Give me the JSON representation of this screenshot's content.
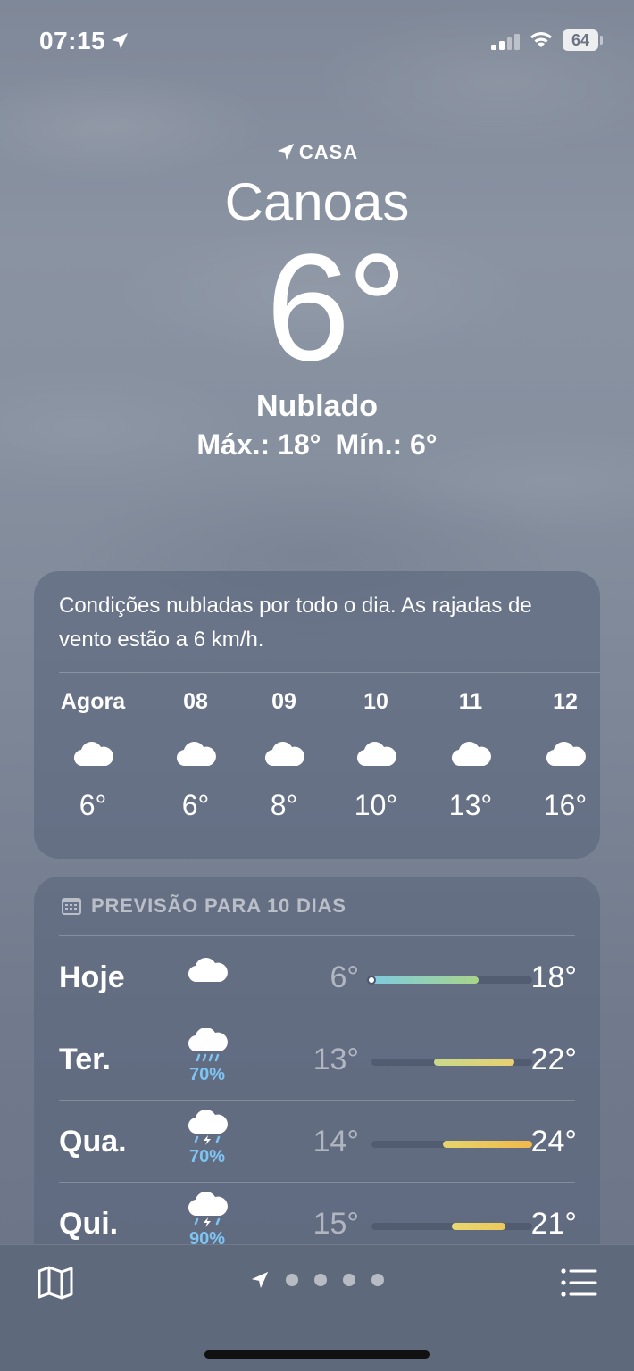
{
  "status_bar": {
    "time": "07:15",
    "battery": "64"
  },
  "header": {
    "location_label": "CASA",
    "city": "Canoas",
    "temperature": "6°",
    "condition": "Nublado",
    "high": "Máx.: 18°",
    "low": "Mín.: 6°"
  },
  "hourly": {
    "summary": "Condições nubladas por todo o dia. As rajadas de vento estão a 6 km/h.",
    "items": [
      {
        "time": "Agora",
        "icon": "cloud-icon",
        "temp": "6°"
      },
      {
        "time": "08",
        "icon": "cloud-icon",
        "temp": "6°"
      },
      {
        "time": "09",
        "icon": "cloud-icon",
        "temp": "8°"
      },
      {
        "time": "10",
        "icon": "cloud-icon",
        "temp": "10°"
      },
      {
        "time": "11",
        "icon": "cloud-icon",
        "temp": "13°"
      },
      {
        "time": "12",
        "icon": "cloud-icon",
        "temp": "16°"
      }
    ]
  },
  "daily": {
    "header": "PREVISÃO PARA 10 DIAS",
    "range": [
      6,
      24
    ],
    "days": [
      {
        "name": "Hoje",
        "icon": "cloud-icon",
        "precip": "",
        "low": "6°",
        "high": "18°",
        "low_val": 6,
        "high_val": 18,
        "current_val": 6,
        "bar_colors": [
          "#7dcbe0",
          "#a8d48a"
        ]
      },
      {
        "name": "Ter.",
        "icon": "cloud-rain-icon",
        "precip": "70%",
        "low": "13°",
        "high": "22°",
        "low_val": 13,
        "high_val": 22,
        "bar_colors": [
          "#c9d88a",
          "#e8d070"
        ]
      },
      {
        "name": "Qua.",
        "icon": "cloud-bolt-rain-icon",
        "precip": "70%",
        "low": "14°",
        "high": "24°",
        "low_val": 14,
        "high_val": 24,
        "bar_colors": [
          "#e6d46c",
          "#f0b94a"
        ]
      },
      {
        "name": "Qui.",
        "icon": "cloud-bolt-rain-icon",
        "precip": "90%",
        "low": "15°",
        "high": "21°",
        "low_val": 15,
        "high_val": 21,
        "bar_colors": [
          "#e8d870",
          "#ecc85a"
        ]
      }
    ]
  },
  "bottom_bar": {
    "page_count": 4
  }
}
